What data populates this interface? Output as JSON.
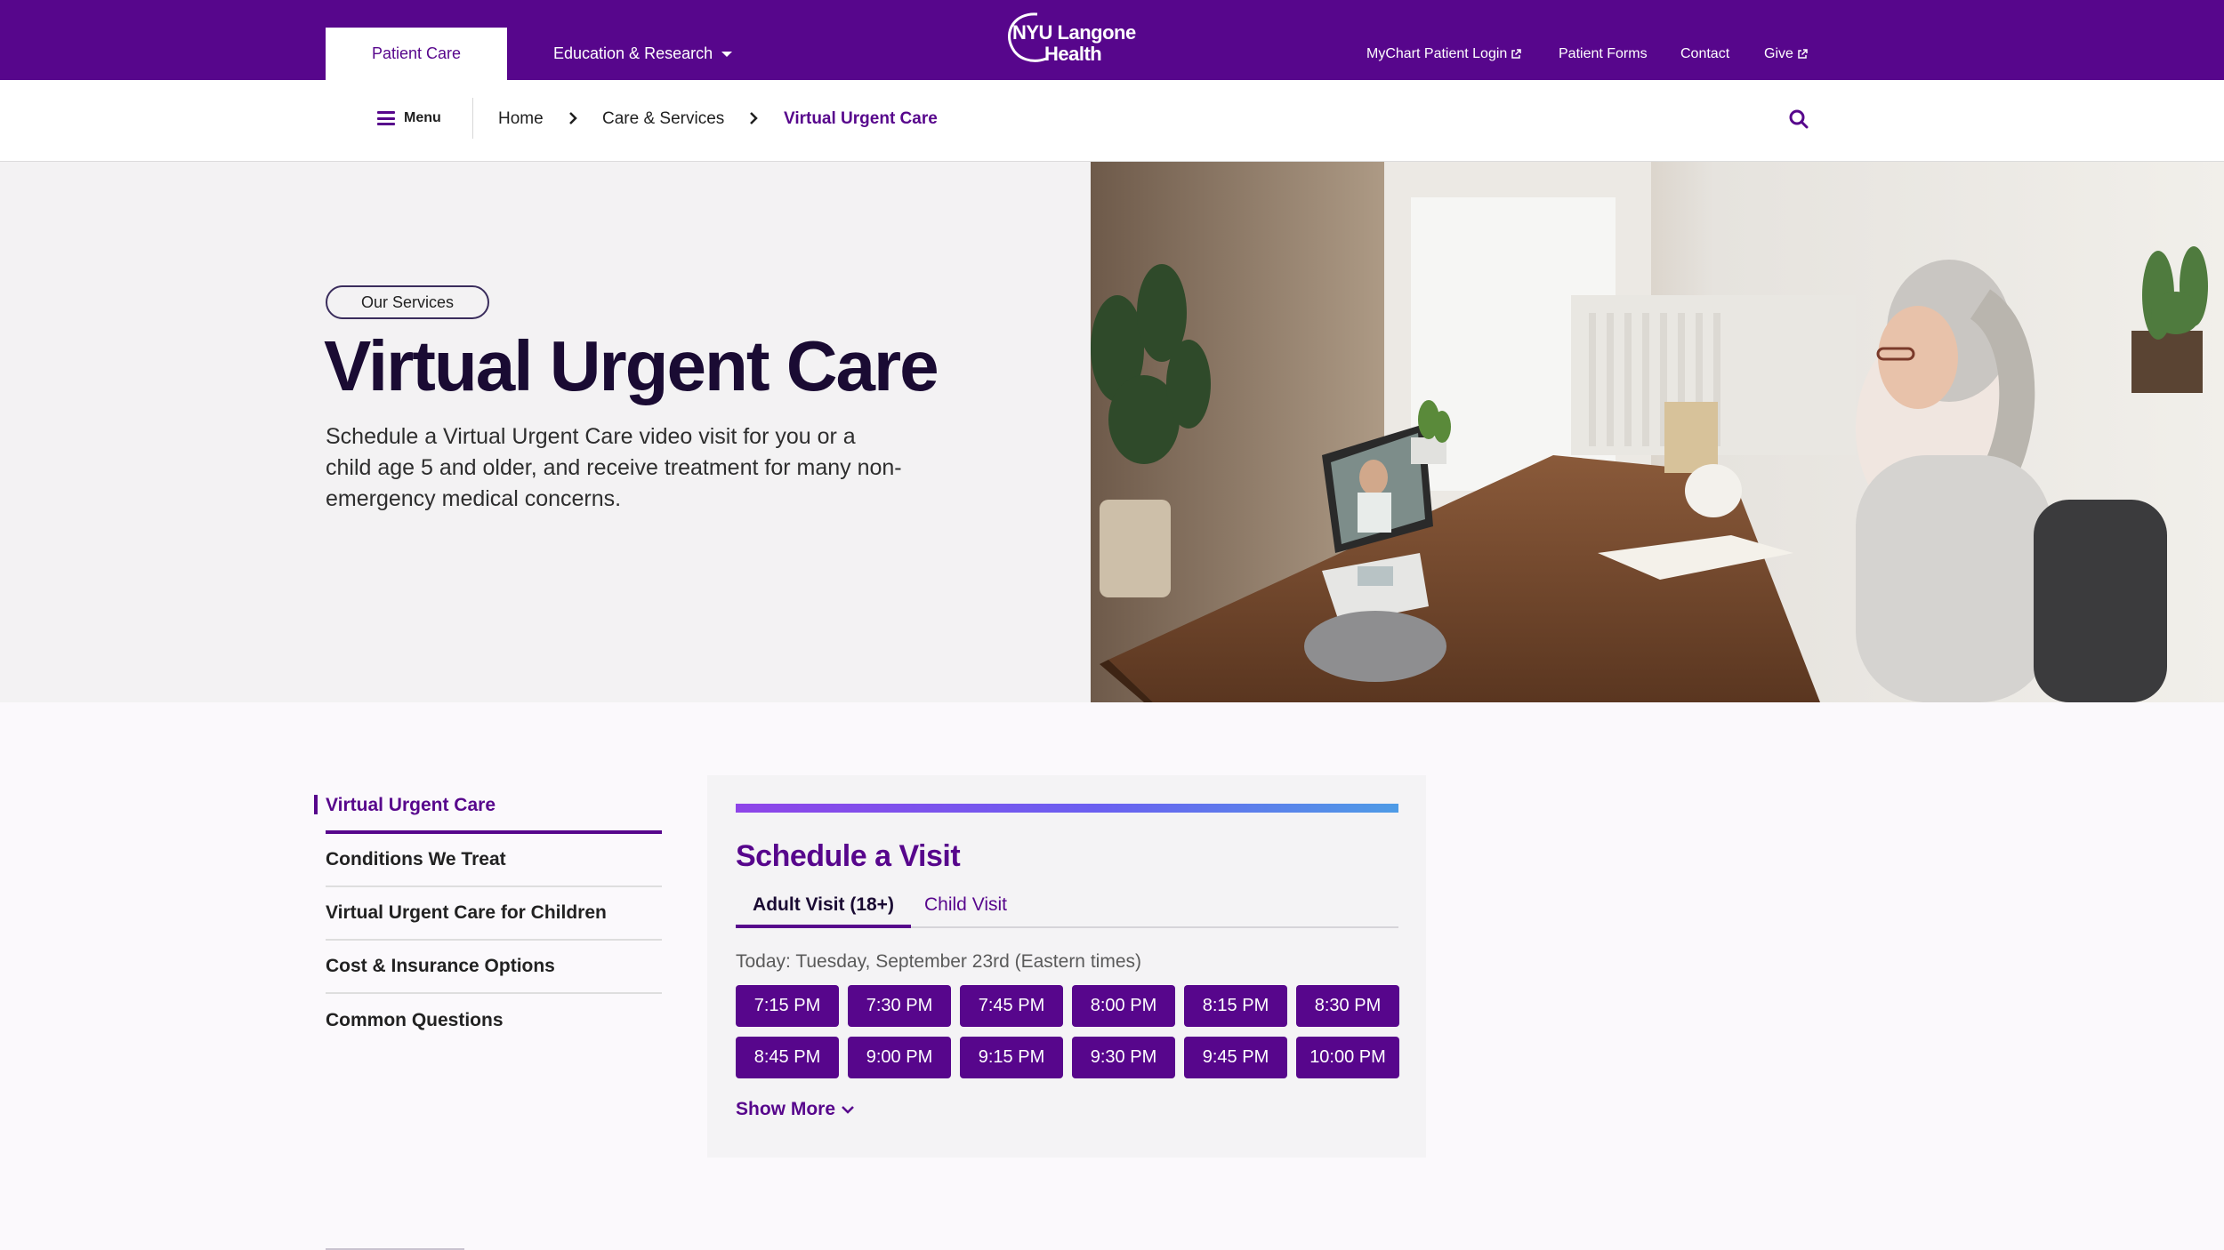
{
  "header": {
    "tabs": [
      {
        "label": "Patient Care"
      },
      {
        "label": "Education & Research"
      }
    ],
    "logo": {
      "line1": "NYU Langone",
      "line2": "Health"
    },
    "utility_links": [
      {
        "label": "MyChart Patient Login",
        "external": true
      },
      {
        "label": "Patient Forms",
        "external": false
      },
      {
        "label": "Contact",
        "external": false
      },
      {
        "label": "Give",
        "external": true
      }
    ]
  },
  "navbar": {
    "menu_label": "Menu",
    "breadcrumb": [
      "Home",
      "Care & Services",
      "Virtual Urgent Care"
    ]
  },
  "hero": {
    "pill": "Our Services",
    "title": "Virtual Urgent Care",
    "description": "Schedule a Virtual Urgent Care video visit for you or a child age 5 and older, and receive treatment for many non-emergency medical concerns.",
    "image": "woman-on-video-call-with-doctor-photo"
  },
  "sidenav": {
    "items": [
      {
        "label": "Virtual Urgent Care",
        "active": true
      },
      {
        "label": "Conditions We Treat"
      },
      {
        "label": "Virtual Urgent Care for Children"
      },
      {
        "label": "Cost & Insurance Options"
      },
      {
        "label": "Common Questions"
      }
    ]
  },
  "schedule": {
    "title": "Schedule a Visit",
    "tabs": [
      {
        "label": "Adult Visit (18+)",
        "active": true
      },
      {
        "label": "Child Visit"
      }
    ],
    "today": "Today: Tuesday, September 23rd (Eastern times)",
    "slots": [
      "7:15 PM",
      "7:30 PM",
      "7:45 PM",
      "8:00 PM",
      "8:15 PM",
      "8:30 PM",
      "8:45 PM",
      "9:00 PM",
      "9:15 PM",
      "9:30 PM",
      "9:45 PM",
      "10:00 PM"
    ],
    "show_more": "Show More"
  },
  "colors": {
    "brand": "#57068c",
    "gradient": [
      "#8e44e8",
      "#4e9be6"
    ]
  }
}
